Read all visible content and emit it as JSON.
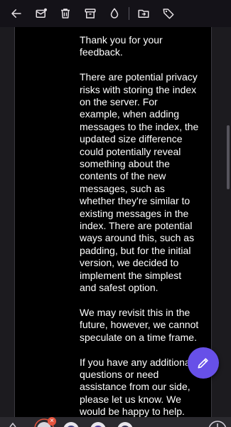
{
  "toolbar": {
    "icons": [
      "back-arrow-icon",
      "mark-unread-icon",
      "trash-icon",
      "archive-icon",
      "tint-icon",
      "move-to-folder-icon",
      "label-icon"
    ]
  },
  "message": {
    "paragraphs": [
      "Thank you for your feedback.",
      "There are potential privacy risks with storing the index on the server. For example, when adding messages to the index, the updated size difference could potentially reveal something about the contents of the new messages, such as whether they're similar to existing messages in the index. There are potential ways around this, such as padding, but for the initial version, we decided to implement the simplest and safest option.",
      "We may revisit this in the future, however, we cannot speculate on a time frame.",
      "If you have any additional questions or need assistance from our side, please let us know. We would be happy to help."
    ]
  },
  "fab": {
    "icon": "pencil-icon"
  },
  "bottom_bar": {
    "close_badge": "×"
  },
  "colors": {
    "background": "#1c1b1f",
    "message_bg": "#000000",
    "text": "#ffffff",
    "accent": "#6750e8",
    "badge": "#e5533d"
  }
}
